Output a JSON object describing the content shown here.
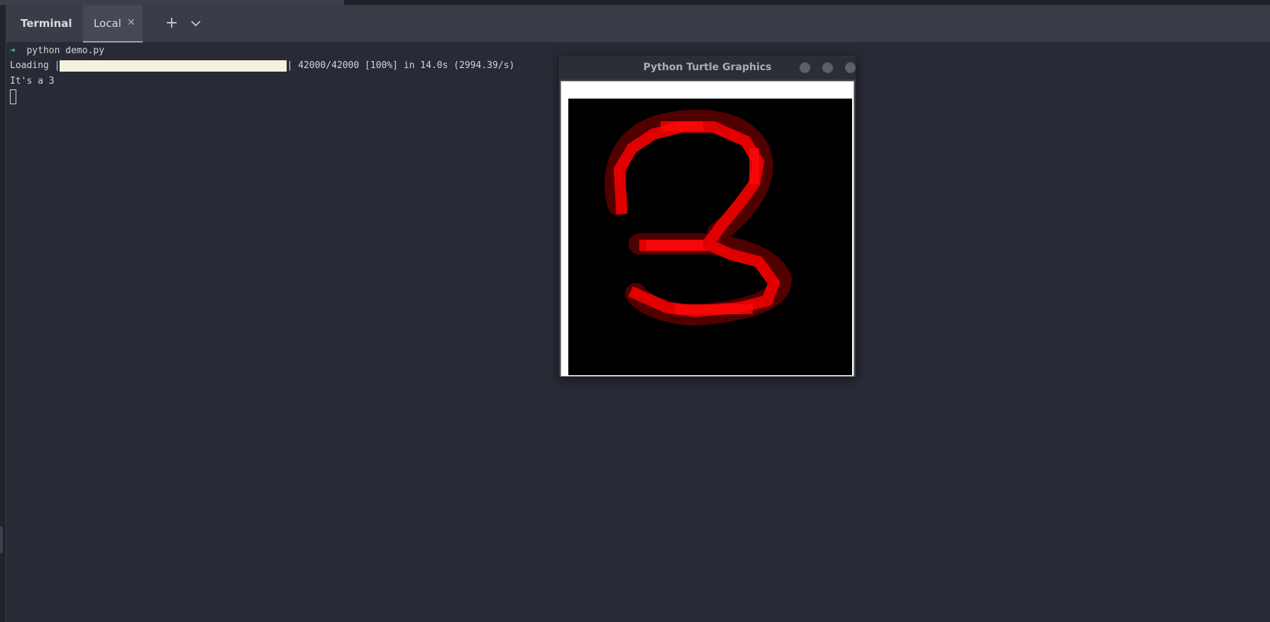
{
  "tool_window": {
    "title": "Terminal",
    "tab": {
      "label": "Local"
    }
  },
  "icons": {
    "close": "close-icon",
    "add": "plus-icon",
    "menu": "chevron-down-icon"
  },
  "terminal": {
    "prompt_symbol": "➜",
    "command": "python demo.py",
    "progress": {
      "prefix": "Loading |",
      "fraction": 1.0,
      "suffix": "| 42000/42000 [100%] in 14.0s (2994.39/s)"
    },
    "output": "It's a 3"
  },
  "turtle_window": {
    "title": "Python Turtle Graphics",
    "digit_shown": "3",
    "colors": {
      "stroke": "#ff0000",
      "background": "#000000"
    }
  }
}
